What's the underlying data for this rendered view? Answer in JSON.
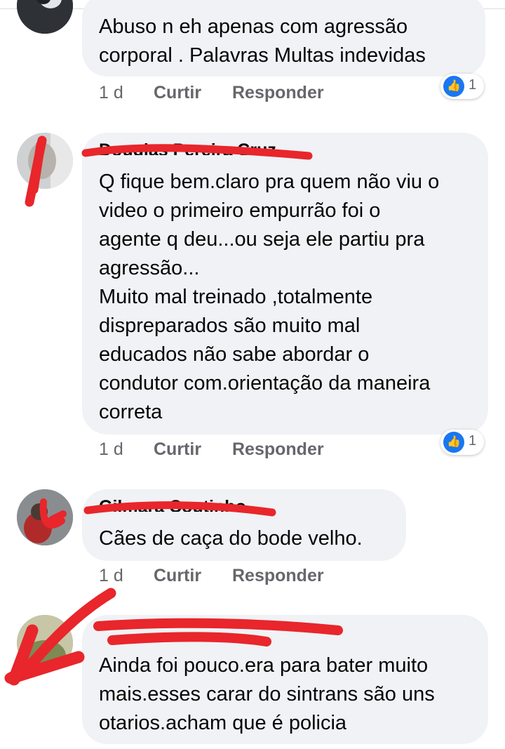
{
  "comments": [
    {
      "author": "",
      "text": "Abuso n eh apenas com agressão\ncorporal . Palavras Multas indevidas",
      "time": "1 d",
      "like_label": "Curtir",
      "reply_label": "Responder",
      "reaction_count": "1",
      "reaction_icon": "thumbs-up-icon"
    },
    {
      "author": "Douglas Pereira Cruz",
      "text": "Q fique bem.claro pra quem não viu o\nvideo o primeiro empurrão foi o\nagente q deu...ou seja ele partiu pra\nagressão...\nMuito mal treinado ,totalmente\ndispreparados são muito mal\neducados não sabe abordar o\ncondutor com.orientação da maneira\ncorreta",
      "time": "1 d",
      "like_label": "Curtir",
      "reply_label": "Responder",
      "reaction_count": "1",
      "reaction_icon": "thumbs-up-icon"
    },
    {
      "author": "Gilmara Coutinho",
      "text": "Cães de caça do bode velho.",
      "time": "1 d",
      "like_label": "Curtir",
      "reply_label": "Responder"
    },
    {
      "author": "",
      "text": "Ainda foi pouco.era para bater muito\nmais.esses carar do sintrans são uns\notarios.acham que é policia"
    }
  ],
  "colors": {
    "bubble": "#f0f2f5",
    "meta_text": "#65676b",
    "like_blue": "#1877f2",
    "redaction_red": "#e8262b"
  }
}
